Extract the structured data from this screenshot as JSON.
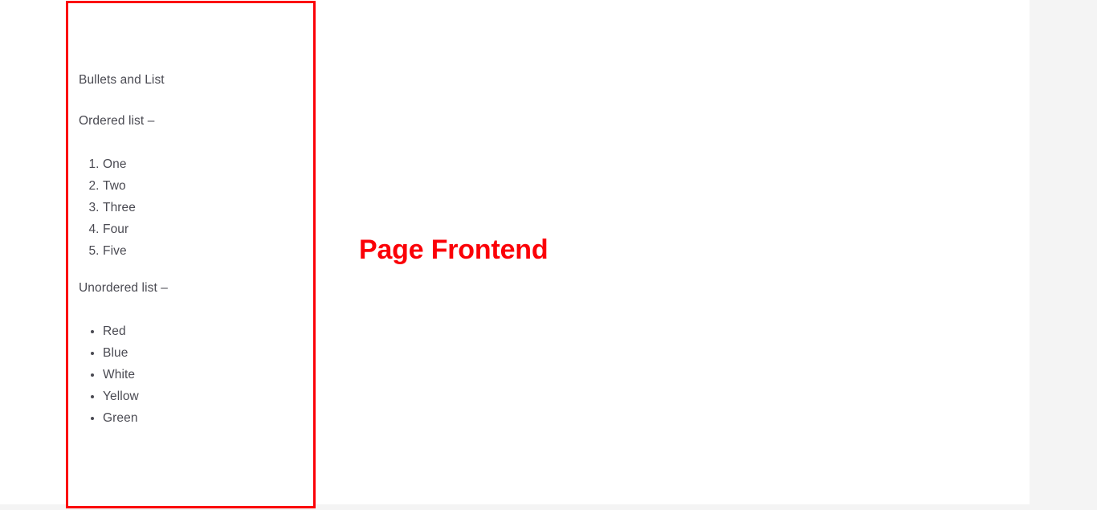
{
  "page": {
    "background_color": "#f4f4f4",
    "canvas_color": "#ffffff",
    "text_color": "#4a4a52",
    "annotation_color": "#fb0007"
  },
  "content": {
    "heading": "Bullets and List",
    "ordered_section": {
      "label": "Ordered list –",
      "items": [
        "One",
        "Two",
        "Three",
        "Four",
        "Five"
      ]
    },
    "unordered_section": {
      "label": "Unordered list –",
      "items": [
        "Red",
        "Blue",
        "White",
        "Yellow",
        "Green"
      ]
    }
  },
  "annotations": {
    "page_frontend_label": "Page Frontend"
  }
}
